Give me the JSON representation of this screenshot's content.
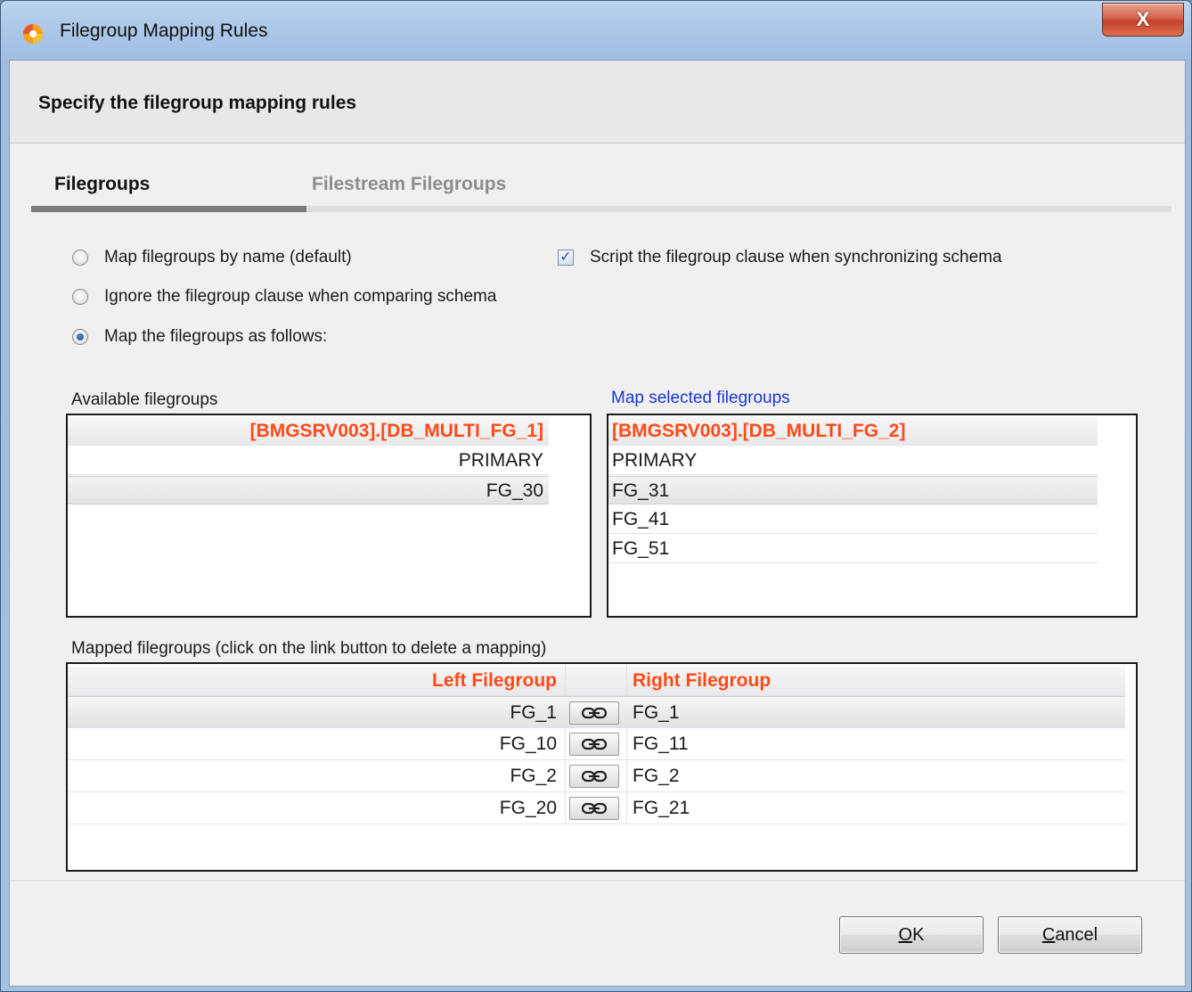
{
  "window": {
    "title": "Filegroup Mapping Rules",
    "close_glyph": "X"
  },
  "header": {
    "title": "Specify the filegroup mapping rules"
  },
  "tabs": [
    {
      "label": "Filegroups",
      "active": true
    },
    {
      "label": "Filestream Filegroups",
      "active": false
    }
  ],
  "options": {
    "map_by_name": {
      "label": "Map filegroups by name (default)",
      "checked": false
    },
    "ignore_clause": {
      "label": "Ignore the filegroup clause when comparing schema",
      "checked": false
    },
    "map_as_follows": {
      "label": "Map the filegroups as follows:",
      "checked": true
    },
    "script_clause": {
      "label": "Script the filegroup clause when synchronizing schema",
      "checked": true
    }
  },
  "available": {
    "label": "Available filegroups",
    "header": "[BMGSRV003].[DB_MULTI_FG_1]",
    "items": [
      "PRIMARY",
      "FG_30"
    ],
    "selected_index": 1
  },
  "map_selected": {
    "label": "Map selected filegroups",
    "header": "[BMGSRV003].[DB_MULTI_FG_2]",
    "items": [
      "PRIMARY",
      "FG_31",
      "FG_41",
      "FG_51"
    ],
    "selected_index": 1
  },
  "mapped": {
    "label": "Mapped filegroups (click on the link button to delete a mapping)",
    "left_header": "Left Filegroup",
    "right_header": "Right Filegroup",
    "rows": [
      {
        "left": "FG_1",
        "right": "FG_1"
      },
      {
        "left": "FG_10",
        "right": "FG_11"
      },
      {
        "left": "FG_2",
        "right": "FG_2"
      },
      {
        "left": "FG_20",
        "right": "FG_21"
      }
    ],
    "selected_index": 0,
    "link_icon": "chain-link-icon"
  },
  "buttons": {
    "ok": {
      "mnemonic": "O",
      "rest": "K"
    },
    "cancel": {
      "mnemonic": "C",
      "rest": "ancel"
    }
  },
  "colors": {
    "header_orange": "#ff4a1a",
    "label_blue": "#1b36d6"
  }
}
